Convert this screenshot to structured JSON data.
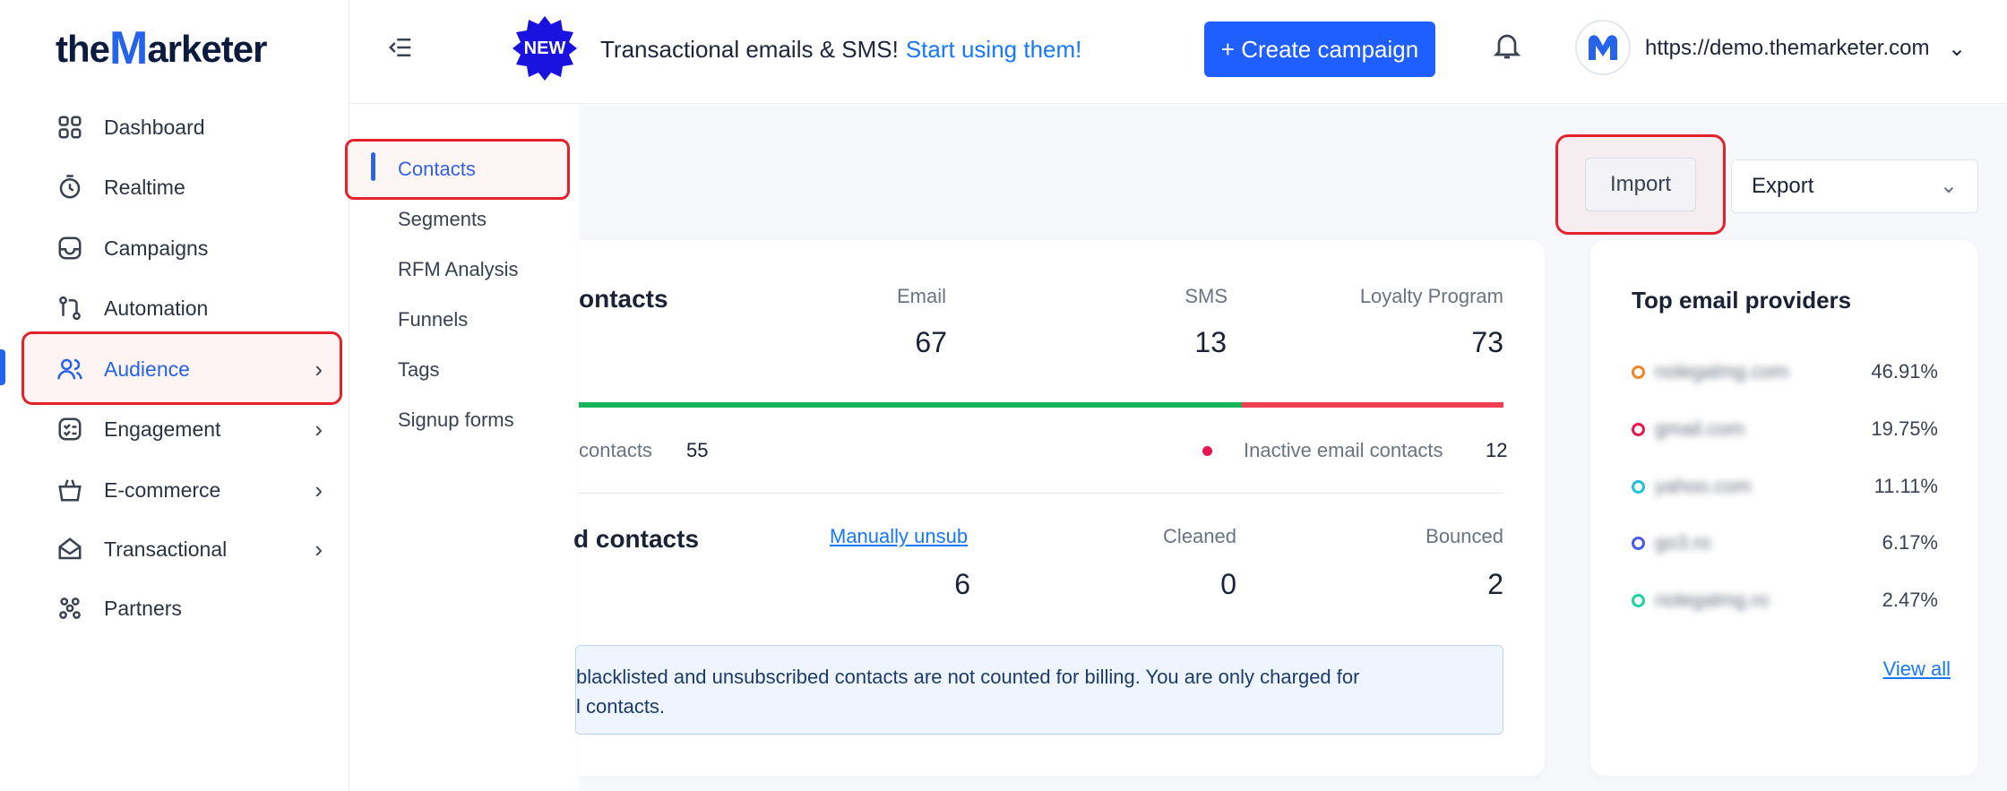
{
  "brand": {
    "logo_pre": "the",
    "logo_m": "M",
    "logo_post": "arketer"
  },
  "sidebar": {
    "items": [
      {
        "label": "Dashboard",
        "icon": "grid-icon"
      },
      {
        "label": "Realtime",
        "icon": "stopwatch-icon"
      },
      {
        "label": "Campaigns",
        "icon": "folder-icon"
      },
      {
        "label": "Automation",
        "icon": "workflow-icon"
      },
      {
        "label": "Audience",
        "icon": "users-icon",
        "active": true,
        "chevron": "›"
      },
      {
        "label": "Engagement",
        "icon": "checklist-icon",
        "chevron": "›"
      },
      {
        "label": "E-commerce",
        "icon": "basket-icon",
        "chevron": "›"
      },
      {
        "label": "Transactional",
        "icon": "mail-open-icon",
        "chevron": "›"
      },
      {
        "label": "Partners",
        "icon": "people-group-icon"
      }
    ]
  },
  "topbar": {
    "badge": "NEW",
    "announcement": "Transactional emails & SMS!",
    "announcement_link": "Start using them!",
    "create_button": "+ Create campaign",
    "site_url": "https://demo.themarketer.com",
    "site_chevron": "⌄"
  },
  "submenu": {
    "items": [
      "Contacts",
      "Segments",
      "RFM Analysis",
      "Funnels",
      "Tags",
      "Signup forms"
    ]
  },
  "actions": {
    "import": "Import",
    "export": "Export",
    "export_chevron": "⌄"
  },
  "contacts_card": {
    "title": "ontacts",
    "email_label": "Email",
    "email_value": "67",
    "sms_label": "SMS",
    "sms_value": "13",
    "loyalty_label": "Loyalty Program",
    "loyalty_value": "73",
    "active_label": "contacts",
    "active_value": "55",
    "inactive_label": "Inactive email contacts",
    "inactive_value": "12",
    "blocked_title": "d contacts",
    "manual_label": "Manually unsub",
    "manual_value": "6",
    "cleaned_label": "Cleaned",
    "cleaned_value": "0",
    "bounced_label": "Bounced",
    "bounced_value": "2",
    "info_line1": "blacklisted and unsubscribed contacts are not counted for billing. You are only charged for",
    "info_line2": "l contacts.",
    "colors": {
      "green": "#18b45a",
      "red": "#ef3f52"
    },
    "green_fraction": 0.72
  },
  "providers": {
    "title": "Top email providers",
    "items": [
      {
        "name": "nolegalmg.com",
        "pct": "46.91%",
        "color": "#f0842a"
      },
      {
        "name": "gmail.com",
        "pct": "19.75%",
        "color": "#e7164e"
      },
      {
        "name": "yahoo.com",
        "pct": "11.11%",
        "color": "#1fc2d6"
      },
      {
        "name": "go3.ro",
        "pct": "6.17%",
        "color": "#4a5ae8"
      },
      {
        "name": "nolegalmg.ro",
        "pct": "2.47%",
        "color": "#1fd2a0"
      }
    ],
    "view_all": "View all"
  }
}
